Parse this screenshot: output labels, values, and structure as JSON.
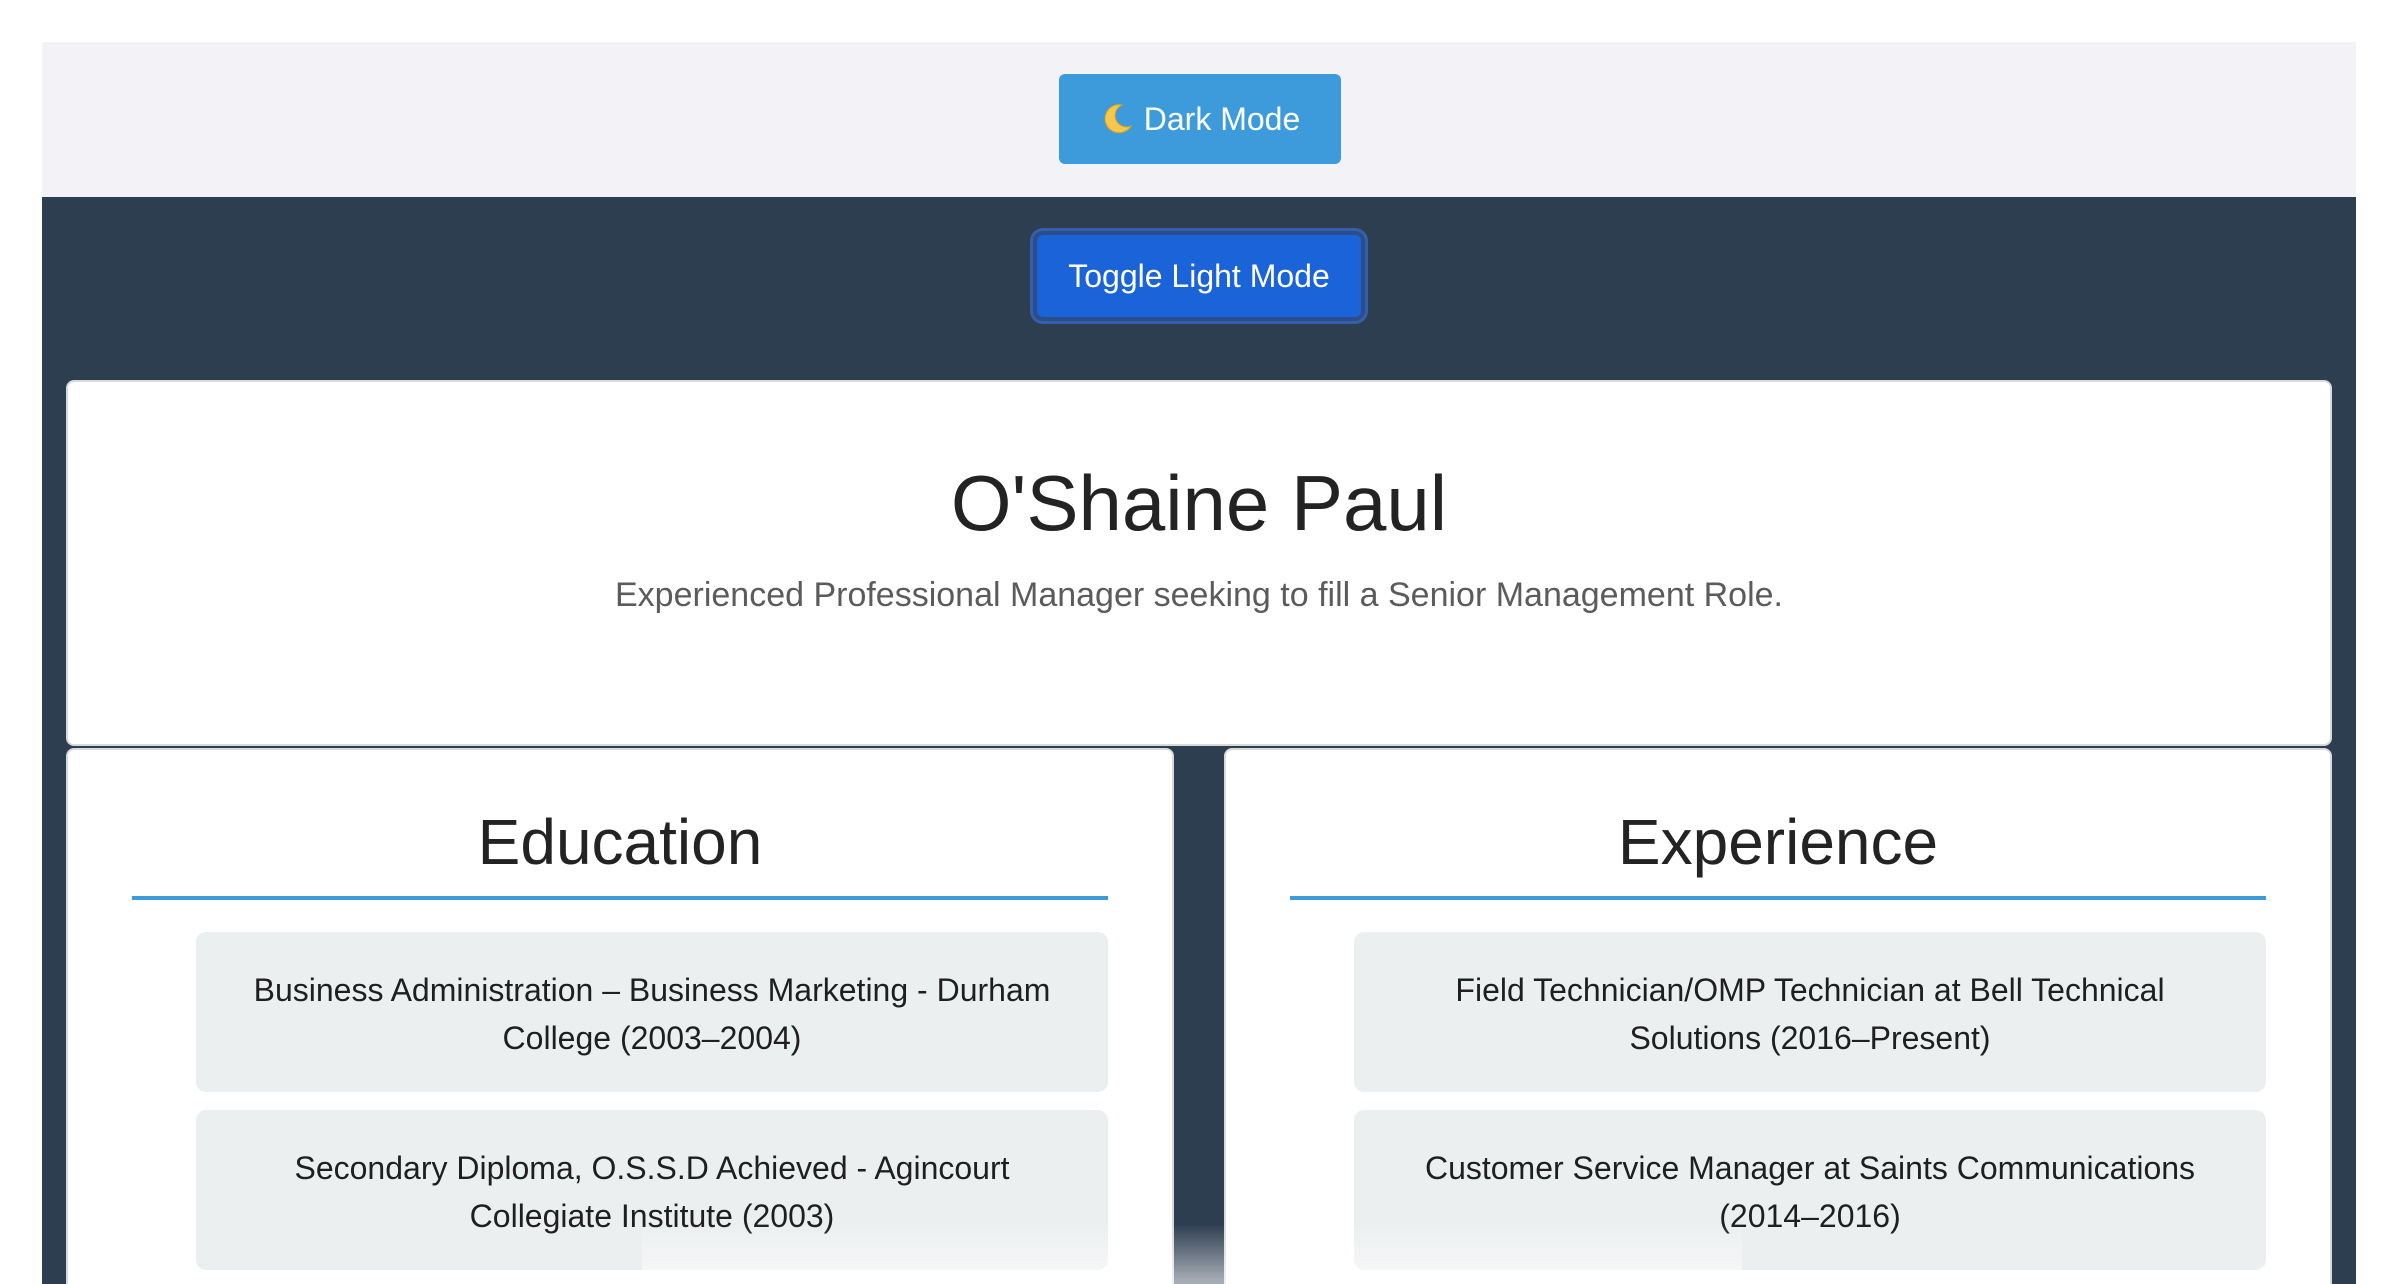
{
  "topbar": {
    "dark_mode_label": "Dark Mode",
    "moon_icon": "moon-icon"
  },
  "main": {
    "toggle_label": "Toggle Light Mode"
  },
  "header": {
    "name": "O'Shaine Paul",
    "summary": "Experienced Professional Manager seeking to fill a Senior Management Role."
  },
  "education": {
    "title": "Education",
    "items": [
      "Business Administration – Business Marketing - Durham College (2003–2004)",
      "Secondary Diploma, O.S.S.D Achieved - Agincourt Collegiate Institute (2003)"
    ]
  },
  "experience": {
    "title": "Experience",
    "items": [
      "Field Technician/OMP Technician at Bell Technical Solutions (2016–Present)",
      "Customer Service Manager at Saints Communications (2014–2016)"
    ]
  },
  "colors": {
    "accent": "#3d9bdc",
    "toggle": "#1a63d9",
    "dark_bg": "#2e3e51",
    "light_bg": "#f3f3f7",
    "entry_bg": "#eceff0"
  }
}
